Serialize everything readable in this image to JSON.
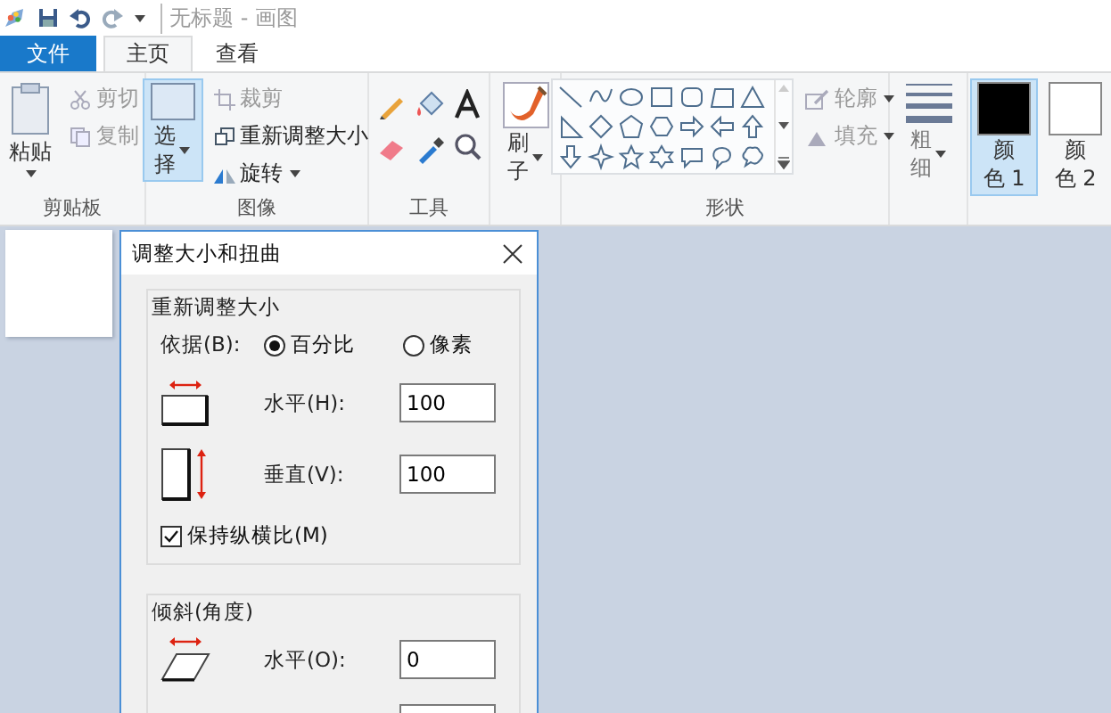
{
  "title_bar": {
    "title": "无标题 - 画图"
  },
  "tabs": [
    {
      "label": "文件",
      "kind": "file",
      "selected": false
    },
    {
      "label": "主页",
      "kind": "tab",
      "selected": true
    },
    {
      "label": "查看",
      "kind": "tab",
      "selected": false
    }
  ],
  "ribbon": {
    "clipboard": {
      "label": "剪贴板",
      "paste": {
        "label": "粘贴"
      },
      "cut": {
        "label": "剪切",
        "disabled": true
      },
      "copy": {
        "label": "复制",
        "disabled": true
      }
    },
    "image": {
      "label": "图像",
      "select": {
        "label": "选择",
        "selected": true
      },
      "crop": {
        "label": "裁剪",
        "disabled": true
      },
      "resize": {
        "label": "重新调整大小",
        "disabled": false
      },
      "rotate": {
        "label": "旋转",
        "disabled": false
      }
    },
    "tools": {
      "label": "工具"
    },
    "brushes": {
      "label": "刷子"
    },
    "shapes": {
      "label": "形状",
      "outline": {
        "label": "轮廓",
        "disabled": true
      },
      "fill": {
        "label": "填充",
        "disabled": true
      }
    },
    "size": {
      "label": "粗细"
    },
    "colors": [
      {
        "label": "颜色 1",
        "selected": true,
        "color": "#000000"
      },
      {
        "label": "颜色 2",
        "selected": false,
        "color": "#ffffff"
      }
    ]
  },
  "dialog": {
    "title": "调整大小和扭曲",
    "resize": {
      "title": "重新调整大小",
      "by_label": "依据(B):",
      "units": [
        {
          "label": "百分比",
          "selected": true
        },
        {
          "label": "像素",
          "selected": false
        }
      ],
      "fields": [
        {
          "kind": "horizontal",
          "label": "水平(H):",
          "value": "100"
        },
        {
          "kind": "vertical",
          "label": "垂直(V):",
          "value": "100"
        }
      ],
      "keep_ratio": {
        "label": "保持纵横比(M)",
        "checked": true
      }
    },
    "skew": {
      "title": "倾斜(角度)",
      "fields": [
        {
          "kind": "horizontal",
          "label": "水平(O):",
          "value": "0"
        }
      ]
    }
  }
}
